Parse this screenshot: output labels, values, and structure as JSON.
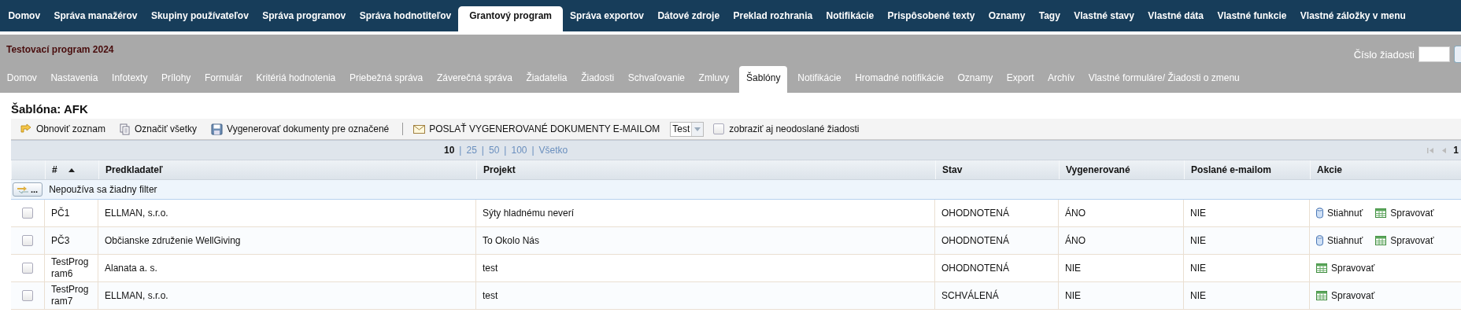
{
  "top_nav": [
    {
      "label": "Domov",
      "selected": false
    },
    {
      "label": "Správa manažérov",
      "selected": false
    },
    {
      "label": "Skupiny používateľov",
      "selected": false
    },
    {
      "label": "Správa programov",
      "selected": false
    },
    {
      "label": "Správa hodnotiteľov",
      "selected": false
    },
    {
      "label": "Grantový program",
      "selected": true
    },
    {
      "label": "Správa exportov",
      "selected": false
    },
    {
      "label": "Dátové zdroje",
      "selected": false
    },
    {
      "label": "Preklad rozhrania",
      "selected": false
    },
    {
      "label": "Notifikácie",
      "selected": false
    },
    {
      "label": "Prispôsobené texty",
      "selected": false
    },
    {
      "label": "Oznamy",
      "selected": false
    },
    {
      "label": "Tagy",
      "selected": false
    },
    {
      "label": "Vlastné stavy",
      "selected": false
    },
    {
      "label": "Vlastné dáta",
      "selected": false
    },
    {
      "label": "Vlastné funkcie",
      "selected": false
    },
    {
      "label": "Vlastné záložky v menu",
      "selected": false
    }
  ],
  "program_title": "Testovací program 2024",
  "request_search": {
    "label": "Číslo žiadosti"
  },
  "sub_nav": [
    {
      "label": "Domov",
      "selected": false
    },
    {
      "label": "Nastavenia",
      "selected": false
    },
    {
      "label": "Infotexty",
      "selected": false
    },
    {
      "label": "Prílohy",
      "selected": false
    },
    {
      "label": "Formulár",
      "selected": false
    },
    {
      "label": "Kritériá hodnotenia",
      "selected": false
    },
    {
      "label": "Priebežná správa",
      "selected": false
    },
    {
      "label": "Záverečná správa",
      "selected": false
    },
    {
      "label": "Žiadatelia",
      "selected": false
    },
    {
      "label": "Žiadosti",
      "selected": false
    },
    {
      "label": "Schvaľovanie",
      "selected": false
    },
    {
      "label": "Zmluvy",
      "selected": false
    },
    {
      "label": "Šablóny",
      "selected": true
    },
    {
      "label": "Notifikácie",
      "selected": false
    },
    {
      "label": "Hromadné notifikácie",
      "selected": false
    },
    {
      "label": "Oznamy",
      "selected": false
    },
    {
      "label": "Export",
      "selected": false
    },
    {
      "label": "Archív",
      "selected": false
    },
    {
      "label": "Vlastné formuláre/ Žiadosti o zmenu",
      "selected": false
    }
  ],
  "page_title": "Šablóna: AFK",
  "toolbar": {
    "refresh": "Obnoviť zoznam",
    "select_all": "Označiť všetky",
    "generate": "Vygenerovať dokumenty pre označené",
    "send_email": "POSLAŤ VYGENEROVANÉ DOKUMENTY E-MAILOM",
    "template_select": {
      "value": "Test"
    },
    "show_unsent": {
      "label": "zobraziť aj neodoslané žiadosti",
      "checked": false
    }
  },
  "pager": {
    "separator": "|",
    "sizes": [
      {
        "label": "10",
        "selected": true
      },
      {
        "label": "25",
        "selected": false
      },
      {
        "label": "50",
        "selected": false
      },
      {
        "label": "100",
        "selected": false
      },
      {
        "label": "Všetko",
        "selected": false
      }
    ],
    "page": "1"
  },
  "table": {
    "columns": [
      {
        "label": "#",
        "sorted": true
      },
      {
        "label": "Predkladateľ",
        "sorted": false
      },
      {
        "label": "Projekt",
        "sorted": false
      },
      {
        "label": "Stav",
        "sorted": false
      },
      {
        "label": "Vygenerované",
        "sorted": false
      },
      {
        "label": "Poslané e-mailom",
        "sorted": false
      },
      {
        "label": "Akcie",
        "sorted": false
      }
    ],
    "filter": {
      "button": "...",
      "text": "Nepoužíva sa žiadny filter"
    },
    "rows": [
      {
        "checked": false,
        "number": "PČ1",
        "applicant": "ELLMAN, s.r.o.",
        "project": "Sýty hladnému neverí",
        "status": "OHODNOTENÁ",
        "generated": "ÁNO",
        "emailed": "NIE",
        "actions": [
          {
            "kind": "download",
            "label": "Stiahnuť"
          },
          {
            "kind": "manage",
            "label": "Spravovať"
          }
        ]
      },
      {
        "checked": false,
        "number": "PČ3",
        "applicant": "Občianske združenie WellGiving",
        "project": "To Okolo Nás",
        "status": "OHODNOTENÁ",
        "generated": "ÁNO",
        "emailed": "NIE",
        "actions": [
          {
            "kind": "download",
            "label": "Stiahnuť"
          },
          {
            "kind": "manage",
            "label": "Spravovať"
          }
        ]
      },
      {
        "checked": false,
        "number": "TestProgram6",
        "applicant": "Alanata a. s.",
        "project": "test",
        "status": "OHODNOTENÁ",
        "generated": "NIE",
        "emailed": "NIE",
        "actions": [
          {
            "kind": "manage",
            "label": "Spravovať"
          }
        ]
      },
      {
        "checked": false,
        "number": "TestProgram7",
        "applicant": "ELLMAN, s.r.o.",
        "project": "test",
        "status": "SCHVÁLENÁ",
        "generated": "NIE",
        "emailed": "NIE",
        "actions": [
          {
            "kind": "manage",
            "label": "Spravovať"
          }
        ]
      }
    ]
  }
}
